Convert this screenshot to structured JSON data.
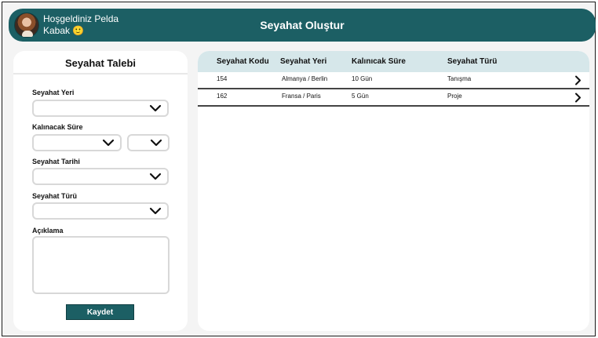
{
  "header": {
    "welcome_line1": "Hoşgeldiniz Pelda",
    "welcome_line2": "Kabak 🙂",
    "app_title": "Seyahat Oluştur"
  },
  "form": {
    "title": "Seyahat Talebi",
    "destination_label": "Seyahat Yeri",
    "duration_label": "Kalınacak Süre",
    "date_label": "Seyahat Tarihi",
    "type_label": "Seyahat Türü",
    "description_label": "Açıklama",
    "save_label": "Kaydet"
  },
  "table": {
    "columns": [
      "Seyahat Kodu",
      "Seyahat Yeri",
      "Kalınıcak Süre",
      "Seyahat Türü"
    ],
    "rows": [
      {
        "code": "154",
        "place": "Almanya / Berlin",
        "duration": "10 Gün",
        "type": "Tanışma"
      },
      {
        "code": "162",
        "place": "Fransa / Paris",
        "duration": "5 Gün",
        "type": "Proje"
      }
    ]
  },
  "icons": {
    "dropdown": "chevron-down-icon",
    "row_open": "chevron-right-icon"
  },
  "colors": {
    "brand": "#1c5f64",
    "table_header": "#d6e7ea"
  }
}
